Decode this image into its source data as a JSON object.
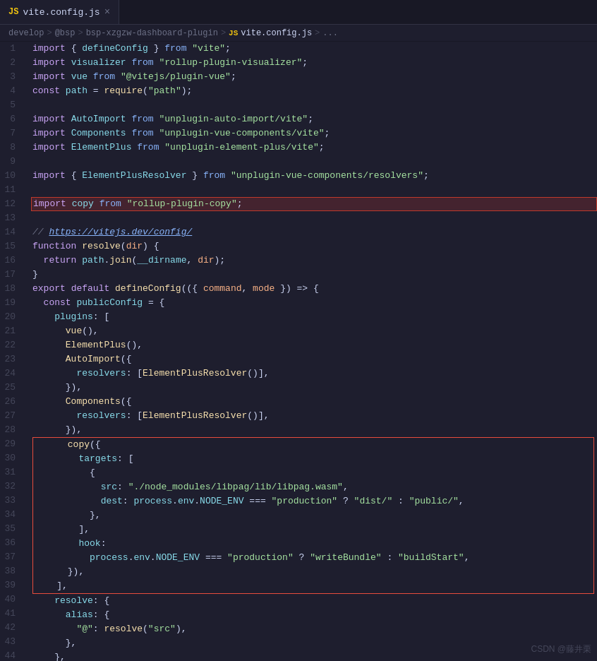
{
  "tab": {
    "icon": "JS",
    "filename": "vite.config.js",
    "close_label": "×"
  },
  "breadcrumb": {
    "parts": [
      "develop",
      ">",
      "@bsp",
      ">",
      "bsp-xzgzw-dashboard-plugin",
      ">",
      "JS vite.config.js",
      ">",
      "..."
    ]
  },
  "lines": [
    {
      "num": 1,
      "code": "import { defineConfig } from \"vite\";"
    },
    {
      "num": 2,
      "code": "import visualizer from \"rollup-plugin-visualizer\";"
    },
    {
      "num": 3,
      "code": "import vue from \"@vitejs/plugin-vue\";"
    },
    {
      "num": 4,
      "code": "const path = require(\"path\");"
    },
    {
      "num": 5,
      "code": ""
    },
    {
      "num": 6,
      "code": "import AutoImport from \"unplugin-auto-import/vite\";"
    },
    {
      "num": 7,
      "code": "import Components from \"unplugin-vue-components/vite\";"
    },
    {
      "num": 8,
      "code": "import ElementPlus from \"unplugin-element-plus/vite\";"
    },
    {
      "num": 9,
      "code": ""
    },
    {
      "num": 10,
      "code": "import { ElementPlusResolver } from \"unplugin-vue-components/resolvers\";"
    },
    {
      "num": 11,
      "code": ""
    },
    {
      "num": 12,
      "code": "import copy from \"rollup-plugin-copy\";"
    },
    {
      "num": 13,
      "code": ""
    },
    {
      "num": 14,
      "code": "// https://vitejs.dev/config/"
    },
    {
      "num": 15,
      "code": "function resolve(dir) {"
    },
    {
      "num": 16,
      "code": "  return path.join(__dirname, dir);"
    },
    {
      "num": 17,
      "code": "}"
    },
    {
      "num": 18,
      "code": "export default defineConfig(({ command, mode }) => {"
    },
    {
      "num": 19,
      "code": "  const publicConfig = {"
    },
    {
      "num": 20,
      "code": "    plugins: ["
    },
    {
      "num": 21,
      "code": "      vue(),"
    },
    {
      "num": 22,
      "code": "      ElementPlus(),"
    },
    {
      "num": 23,
      "code": "      AutoImport({"
    },
    {
      "num": 24,
      "code": "        resolvers: [ElementPlusResolver()],"
    },
    {
      "num": 25,
      "code": "      }),"
    },
    {
      "num": 26,
      "code": "      Components({"
    },
    {
      "num": 27,
      "code": "        resolvers: [ElementPlusResolver()],"
    },
    {
      "num": 28,
      "code": "      }),"
    },
    {
      "num": 29,
      "code": "      copy({"
    },
    {
      "num": 30,
      "code": "        targets: ["
    },
    {
      "num": 31,
      "code": "          {"
    },
    {
      "num": 32,
      "code": "            src: \"./node_modules/libpag/lib/libpag.wasm\","
    },
    {
      "num": 33,
      "code": "            dest: process.env.NODE_ENV === \"production\" ? \"dist/\" : \"public/\","
    },
    {
      "num": 34,
      "code": "          },"
    },
    {
      "num": 35,
      "code": "        ],"
    },
    {
      "num": 36,
      "code": "        hook:"
    },
    {
      "num": 37,
      "code": "          process.env.NODE_ENV === \"production\" ? \"writeBundle\" : \"buildStart\","
    },
    {
      "num": 38,
      "code": "      }),"
    },
    {
      "num": 39,
      "code": "    ],"
    },
    {
      "num": 40,
      "code": "    resolve: {"
    },
    {
      "num": 41,
      "code": "      alias: {"
    },
    {
      "num": 42,
      "code": "        \"@\": resolve(\"src\"),"
    },
    {
      "num": 43,
      "code": "      },"
    },
    {
      "num": 44,
      "code": "    },"
    }
  ],
  "watermark": "CSDN @藤井栗"
}
